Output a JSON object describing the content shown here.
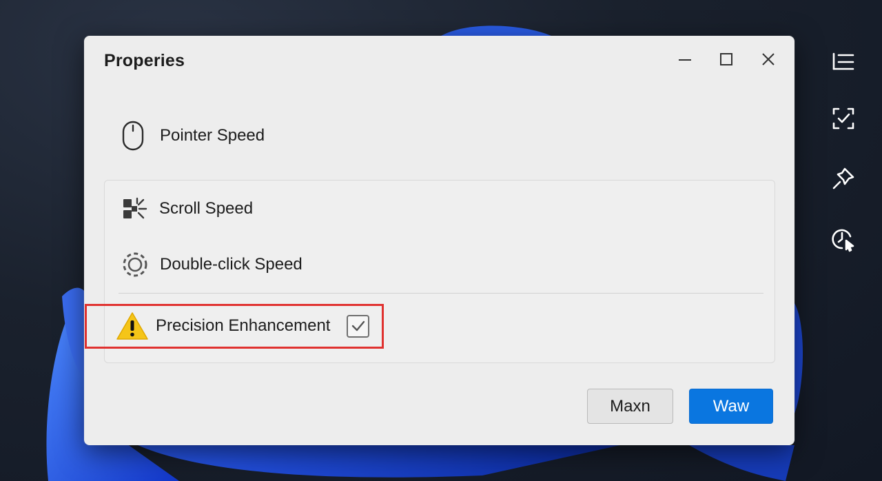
{
  "window": {
    "title": "Properies",
    "controls": [
      "minimize-icon",
      "maximize-icon",
      "close-icon"
    ]
  },
  "settings": {
    "pointer_speed": {
      "label": "Pointer Speed",
      "icon": "mouse-icon"
    },
    "scroll_speed": {
      "label": "Scroll Speed",
      "icon": "scroll-icon"
    },
    "double_click_speed": {
      "label": "Double-click Speed",
      "icon": "gear-icon"
    },
    "precision": {
      "label": "Precision Enhancement",
      "icon": "warning-icon",
      "checked": true
    }
  },
  "buttons": {
    "secondary_label": "Maxn",
    "primary_label": "Waw"
  },
  "side_toolbar": [
    "list-icon",
    "select-check-icon",
    "pin-icon",
    "clock-cursor-icon"
  ],
  "colors": {
    "primary": "#0a76e0",
    "highlight": "#e0312f",
    "warning": "#f5c518"
  }
}
